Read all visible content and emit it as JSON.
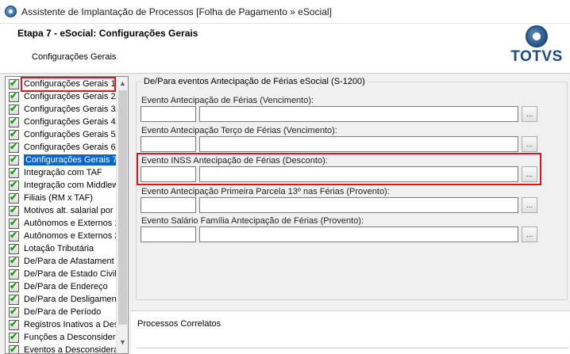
{
  "window": {
    "title": "Assistente de Implantação de Processos [Folha de Pagamento » eSocial]"
  },
  "header": {
    "step_title": "Etapa 7 - eSocial: Configurações Gerais",
    "subtitle": "Configurações Gerais",
    "logo_text": "TOTVS"
  },
  "sidebar": {
    "items": [
      {
        "label": "Configurações Gerais 1/"
      },
      {
        "label": "Configurações Gerais 2/"
      },
      {
        "label": "Configurações Gerais 3/"
      },
      {
        "label": "Configurações Gerais 4/"
      },
      {
        "label": "Configurações Gerais 5/"
      },
      {
        "label": "Configurações Gerais 6/"
      },
      {
        "label": "Configurações Gerais 7",
        "selected": true
      },
      {
        "label": "Integração com TAF"
      },
      {
        "label": "Integração com Middlew"
      },
      {
        "label": "Filiais (RM x TAF)"
      },
      {
        "label": "Motivos alt. salarial por"
      },
      {
        "label": "Autônomos e Externos 1"
      },
      {
        "label": "Autônomos e Externos 2"
      },
      {
        "label": "Lotação Tributária"
      },
      {
        "label": "De/Para de Afastament"
      },
      {
        "label": "De/Para de Estado Civil"
      },
      {
        "label": "De/Para de Endereço"
      },
      {
        "label": "De/Para de Desligament"
      },
      {
        "label": "De/Para de Período"
      },
      {
        "label": "Registros Inativos a Des"
      },
      {
        "label": "Funções a Desconsidera"
      },
      {
        "label": "Eventos a Desconsidera"
      }
    ]
  },
  "group": {
    "legend": "De/Para eventos Antecipação de Férias eSocial (S-1200)",
    "fields": [
      {
        "label": "Evento Antecipação de Férias (Vencimento):",
        "code": "",
        "description": "",
        "button": "..."
      },
      {
        "label": "Evento Antecipação Terço de Férias (Vencimento):",
        "code": "",
        "description": "",
        "button": "..."
      },
      {
        "label": "Evento INSS Antecipação de Férias (Desconto):",
        "code": "",
        "description": "",
        "button": "...",
        "highlighted": true
      },
      {
        "label": "Evento Antecipação Primeira Parcela 13º nas Férias (Provento):",
        "code": "",
        "description": "",
        "button": "..."
      },
      {
        "label": "Evento Salário Família Antecipação de Férias (Provento):",
        "code": "",
        "description": "",
        "button": "..."
      }
    ]
  },
  "bottom": {
    "title": "Processos Correlatos"
  },
  "colors": {
    "selection": "#0a64c9",
    "highlight_border": "#e0121b",
    "brand": "#1d4a7c"
  }
}
